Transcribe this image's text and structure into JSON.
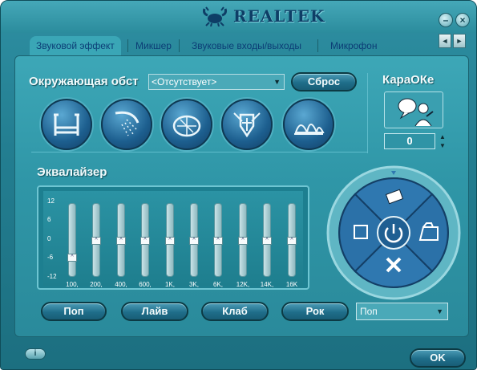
{
  "app": {
    "brand": "REALTEK"
  },
  "window_controls": {
    "minimize": "–",
    "close": "×"
  },
  "tabs": [
    {
      "label": "Звуковой эффект",
      "active": true
    },
    {
      "label": "Микшер",
      "active": false
    },
    {
      "label": "Звуковые входы/выходы",
      "active": false
    },
    {
      "label": "Микрофон",
      "active": false
    }
  ],
  "tab_scroll": {
    "left": "◄",
    "right": "►"
  },
  "environment": {
    "label": "Окружающая обст",
    "selected": "<Отсутствует>",
    "reset_label": "Сброс",
    "icons": [
      "bath-icon",
      "shower-icon",
      "stadium-icon",
      "knight-icon",
      "opera-house-icon"
    ]
  },
  "karaoke": {
    "label": "КараОКе",
    "value": "0",
    "spin_up": "▲",
    "spin_down": "▼"
  },
  "equalizer": {
    "label": "Эквалайзер",
    "scale": [
      "12",
      "6",
      "0",
      "-6",
      "-12"
    ],
    "bands": [
      {
        "freq": "100,",
        "gain": -6
      },
      {
        "freq": "200,",
        "gain": 0
      },
      {
        "freq": "400,",
        "gain": 0
      },
      {
        "freq": "600,",
        "gain": 0
      },
      {
        "freq": "1K,",
        "gain": 0
      },
      {
        "freq": "3K,",
        "gain": 0
      },
      {
        "freq": "6K,",
        "gain": 0
      },
      {
        "freq": "12K,",
        "gain": 0
      },
      {
        "freq": "14K,",
        "gain": 0
      },
      {
        "freq": "16K",
        "gain": 0
      }
    ],
    "thumb_glyph": "^"
  },
  "presets": {
    "buttons": [
      "Поп",
      "Лайв",
      "Клаб",
      "Рок"
    ],
    "selected": "Поп"
  },
  "footer": {
    "ok_label": "OK",
    "info_glyph": "i"
  },
  "colors": {
    "window": "#2e8fa2",
    "panel": "#3da7b7",
    "tab_text": "#0c3e76",
    "dial": "#2b6fa8"
  }
}
